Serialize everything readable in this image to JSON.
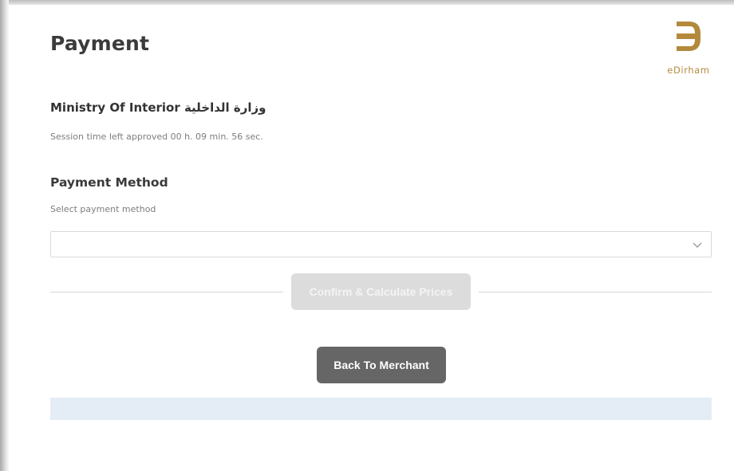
{
  "header": {
    "title": "Payment",
    "logo": {
      "text": "eDirham",
      "icon": "edirham-logo",
      "color": "#b38a3c"
    }
  },
  "merchant": {
    "name": "Ministry Of Interior وزارة الداخلية"
  },
  "session": {
    "text": "Session time left approved 00 h. 09 min. 56 sec."
  },
  "payment_method": {
    "title": "Payment Method",
    "hint": "Select payment method",
    "selected": "",
    "dropdown_icon": "chevron-down-icon"
  },
  "actions": {
    "confirm_label": "Confirm & Calculate Prices",
    "back_label": "Back To Merchant"
  },
  "colors": {
    "accent": "#b38a3c",
    "button_dark": "#666666",
    "button_disabled": "#dcdcdc",
    "info_bar": "#e4edf6"
  }
}
